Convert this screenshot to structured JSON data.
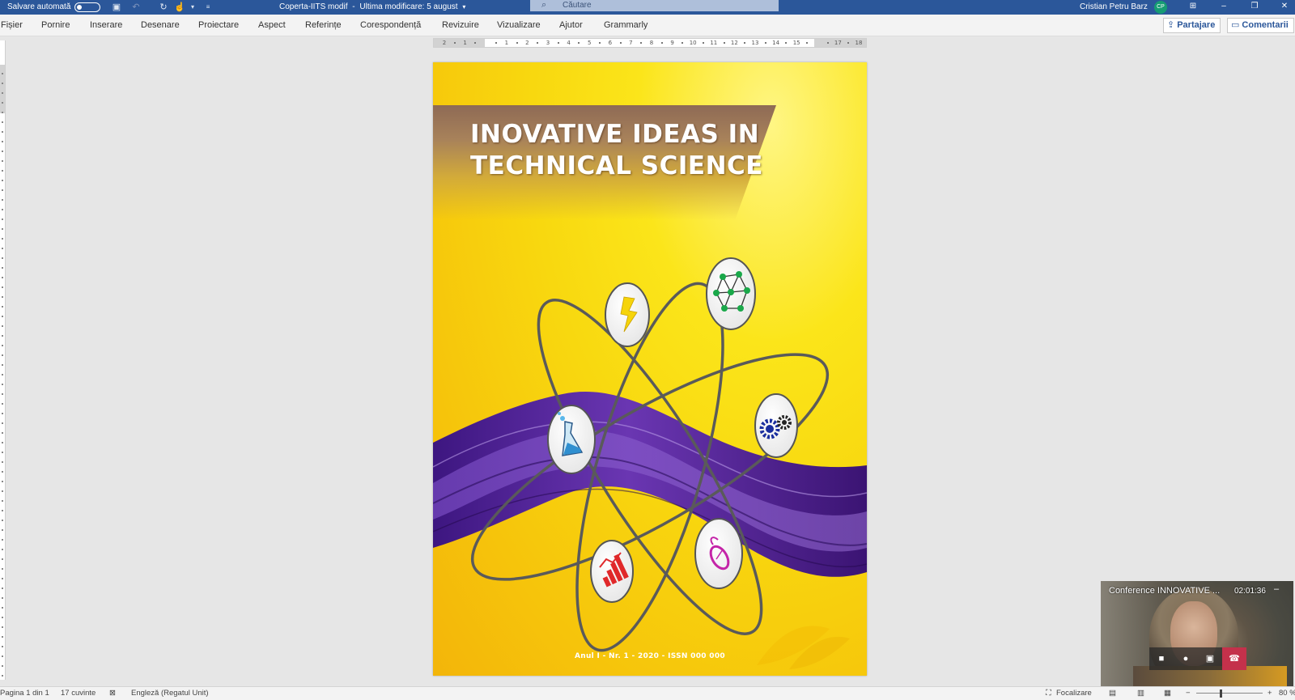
{
  "titlebar": {
    "autosave_label": "Salvare automată",
    "document_title": "Coperta-IITS modif",
    "separator": "-",
    "last_modified": "Ultima modificare: 5 august",
    "dropdown_icon": "chevron-down-icon",
    "search_placeholder": "Căutare",
    "user_name": "Cristian Petru Barz",
    "user_initials": "CP"
  },
  "ribbon": {
    "tabs": [
      "Fișier",
      "Pornire",
      "Inserare",
      "Desenare",
      "Proiectare",
      "Aspect",
      "Referințe",
      "Corespondență",
      "Revizuire",
      "Vizualizare",
      "Ajutor",
      "Grammarly"
    ],
    "share_label": "Partajare",
    "comments_label": "Comentarii"
  },
  "ruler": {
    "labels": [
      "2",
      "1",
      "",
      "1",
      "2",
      "3",
      "4",
      "5",
      "6",
      "7",
      "8",
      "9",
      "10",
      "11",
      "12",
      "13",
      "14",
      "15",
      "",
      "17",
      "18"
    ]
  },
  "cover": {
    "title_line1": "INOVATIVE IDEAS IN",
    "title_line2": "TECHNICAL SCIENCE",
    "footer": "Anul I - Nr. 1 - 2020 - ISSN  000 000",
    "icons": [
      "lightning-icon",
      "network-icon",
      "gears-icon",
      "computer-mouse-icon",
      "bar-chart-icon",
      "flask-icon"
    ],
    "colors": {
      "background": "#f8d80f",
      "wave": "#5a2a9c",
      "banner": "#8e6a55"
    }
  },
  "video_call": {
    "title": "Conference INNOVATIVE ...",
    "time": "02:01:36",
    "minimize": "–",
    "controls": [
      "camera-icon",
      "microphone-icon",
      "share-screen-icon",
      "hang-up-icon"
    ]
  },
  "statusbar": {
    "page": "Pagina 1 din 1",
    "words": "17 cuvinte",
    "language": "Engleză (Regatul Unit)",
    "focus": "Focalizare",
    "zoom": "80 %"
  }
}
